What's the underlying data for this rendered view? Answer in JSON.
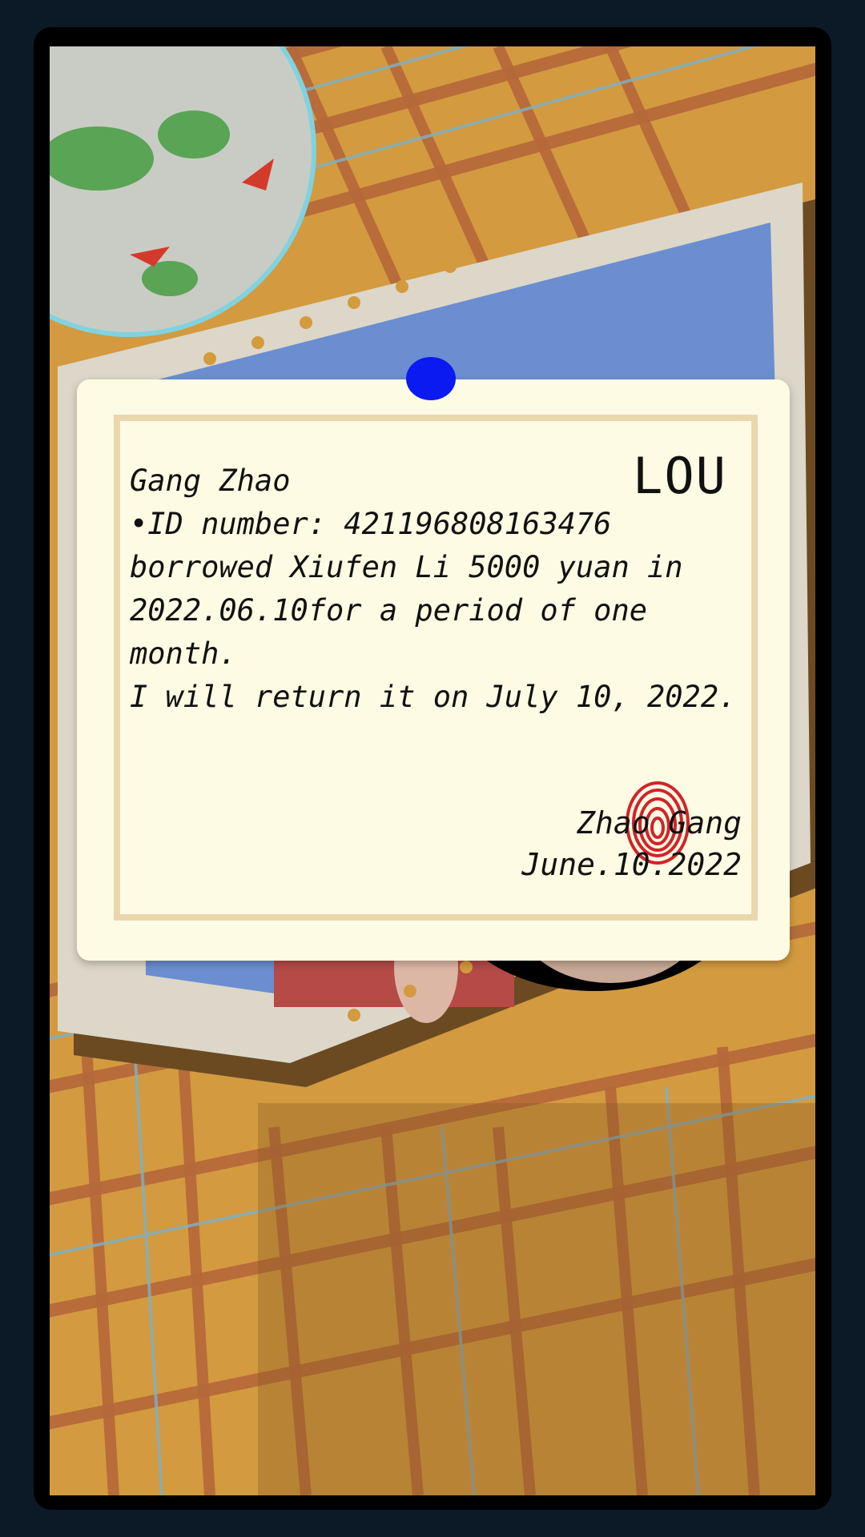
{
  "note": {
    "title": "LOU",
    "lines": [
      "Gang Zhao",
      "•ID number: 421196808163476",
      "borrowed Xiufen Li 5000 yuan in",
      "2022.06.10for a period of one",
      "month.",
      "I will return it on July 10, 2022."
    ],
    "signature_name": "Zhao Gang",
    "signature_date": "June.10.2022"
  },
  "icons": {
    "pin": "push-pin-icon",
    "fingerprint": "fingerprint-stamp-icon"
  },
  "colors": {
    "pin": "#0a1af0",
    "fingerprint": "#d2232a",
    "paper": "#fdfbe3",
    "tablecloth": "#d3953e"
  }
}
